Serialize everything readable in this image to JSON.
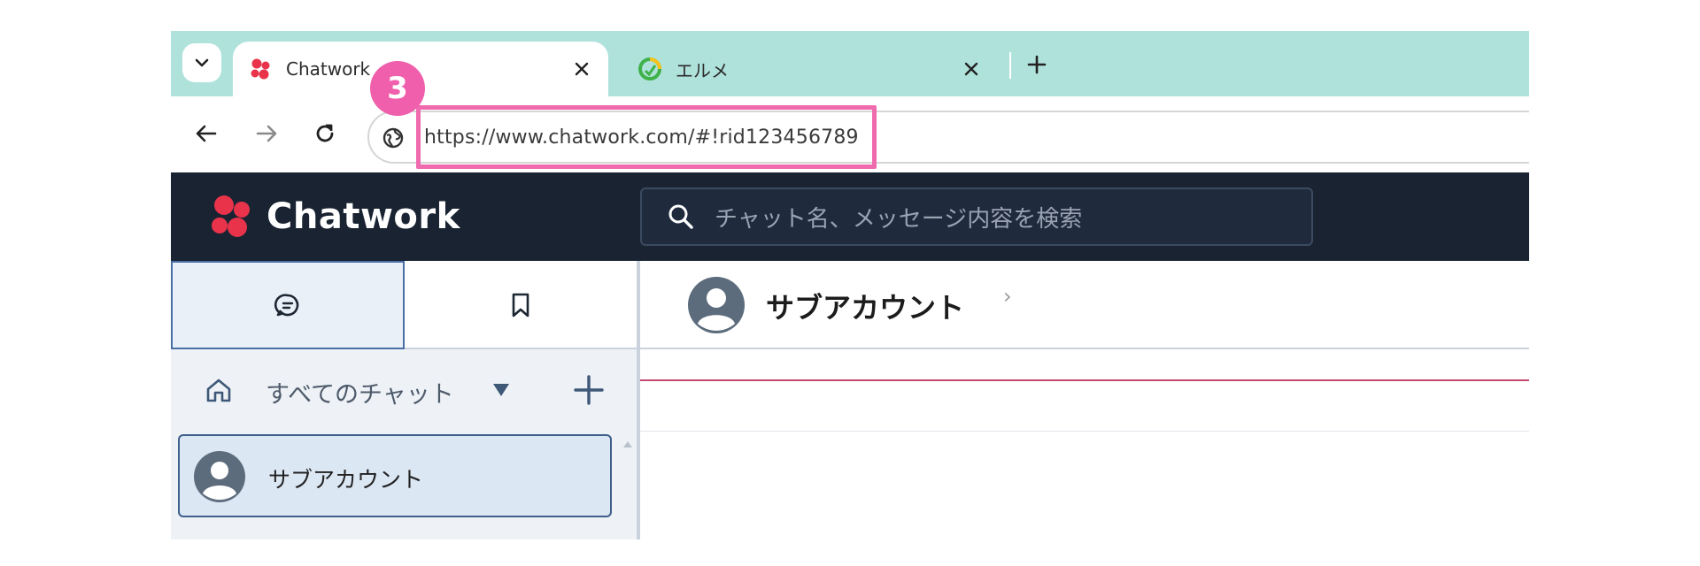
{
  "browser": {
    "tabs": [
      {
        "title": "Chatwork",
        "active": true,
        "favicon": "chatwork-logo-icon"
      },
      {
        "title": "エルメ",
        "active": false,
        "favicon": "lme-logo-icon"
      }
    ],
    "url": "https://www.chatwork.com/#!rid123456789"
  },
  "annotation": {
    "step_number": "3",
    "color": "#ef5fab"
  },
  "app": {
    "brand": "Chatwork",
    "search_placeholder": "チャット名、メッセージ内容を検索",
    "colors": {
      "header_bg": "#192332",
      "accent": "#3f5f8c",
      "brand_red": "#e8334a"
    }
  },
  "left_pane": {
    "filter_label": "すべてのチャット",
    "rooms": [
      {
        "name": "サブアカウント"
      }
    ]
  },
  "main": {
    "room_title": "サブアカウント"
  }
}
